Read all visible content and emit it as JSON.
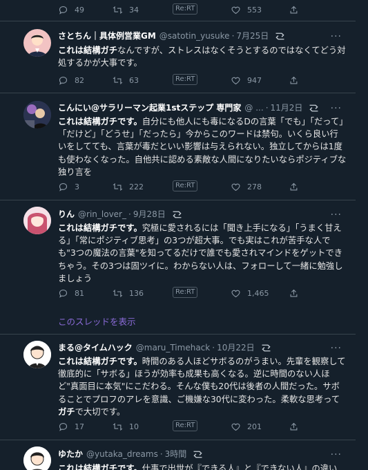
{
  "top_actions": {
    "reply_count": "49",
    "retweet_count": "34",
    "rert_label": "Re:RT",
    "like_count": "553"
  },
  "tweets": [
    {
      "name": "さとちん｜具体例営業GM",
      "handle": "@satotin_yusuke",
      "separator": "·",
      "date": "7月25日",
      "more": "···",
      "bold": "これは結構ガチ",
      "text": "なんですが、ストレスはなくそうとするのではなくてどう対処するかが大事です。",
      "reply_count": "82",
      "retweet_count": "63",
      "rert_label": "Re:RT",
      "like_count": "947"
    },
    {
      "name": "こんにい@サラリーマン起業1stステップ 専門家",
      "handle": "@ ...",
      "separator": "·",
      "date": "11月2日",
      "more": "···",
      "bold": "これは結構ガチです。",
      "text": "自分にも他人にも毒になるDの言葉「でも」「だって」「だけど」「どうせ」「だったら」今からこのワードは禁句。いくら良い行いをしてても、言葉が毒だといい影響は与えられない。独立してからは1度も使わなくなった。自他共に認める素敵な人間になりたいならポジティブな独り言を",
      "reply_count": "3",
      "retweet_count": "222",
      "rert_label": "Re:RT",
      "like_count": "278"
    },
    {
      "name": "りん",
      "handle": "@rin_lover_",
      "separator": "·",
      "date": "9月28日",
      "more": "···",
      "bold": "これは結構ガチです。",
      "text": "究極に愛されるには「聞き上手になる」「うまく甘える」「常にポジティブ思考」の3つが超大事。でも実はこれが苦手な人でも\"3つの魔法の言葉\"を知ってるだけで誰でも愛されマインドをゲットできちゃう。その3つは固ツイに。わからない人は、フォローして一緒に勉強しましょう",
      "reply_count": "81",
      "retweet_count": "136",
      "rert_label": "Re:RT",
      "like_count": "1,465",
      "thread_link": "このスレッドを表示"
    },
    {
      "name": "まる@タイムハック",
      "handle": "@maru_Timehack",
      "separator": "·",
      "date": "10月22日",
      "more": "···",
      "bold": "これは結構ガチです。",
      "text": "時間のある人ほどサボるのがうまい。先輩を観察して徹底的に「サボる」ほうが効率も成果も高くなる。逆に時間のない人ほど\"真面目に本気\"にこだわる。そんな僕も20代は後者の人間だった。サボることでプロフのアレを意識、ご機嫌な30代に変わった。柔軟な思考って",
      "bold2": "ガチ",
      "text2": "で大切です。",
      "reply_count": "17",
      "retweet_count": "10",
      "rert_label": "Re:RT",
      "like_count": "201"
    },
    {
      "name": "ゆたか",
      "handle": "@yutaka_dreams",
      "separator": "·",
      "date": "3時間",
      "more": "···",
      "bold": "これは結構ガチです。",
      "text": "仕事で出世が『できる人』と『できない人』の違い"
    }
  ]
}
